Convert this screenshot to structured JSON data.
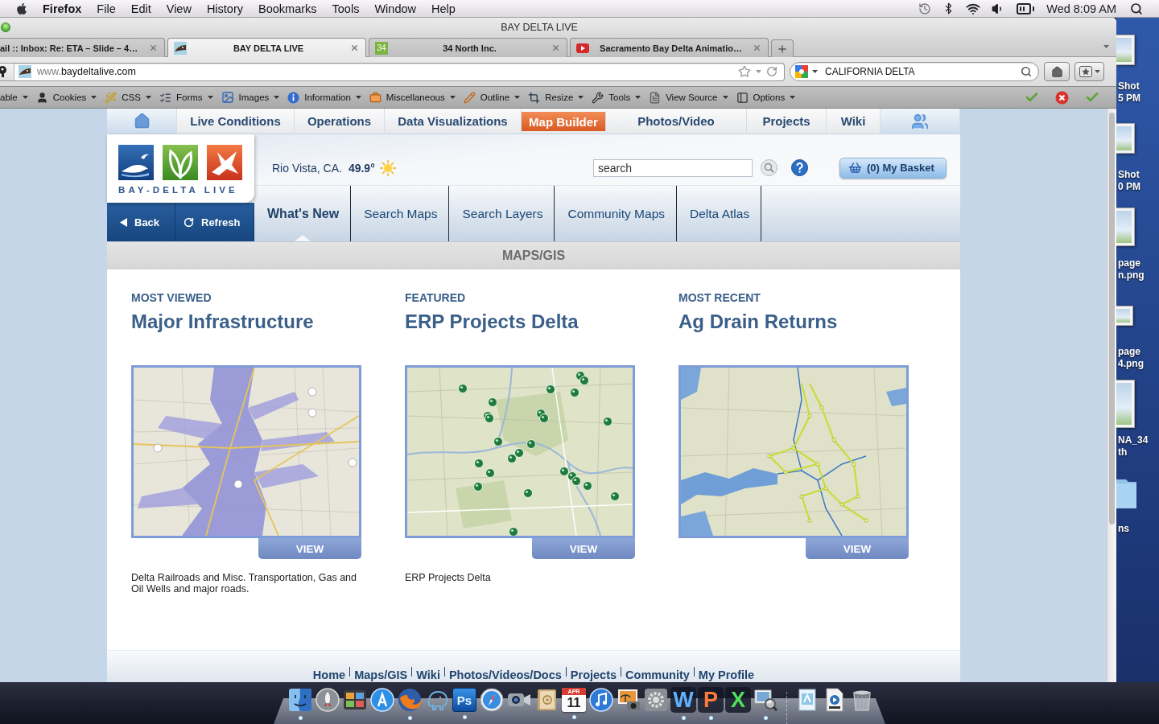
{
  "menu_bar": {
    "app": "Firefox",
    "menus": [
      "File",
      "Edit",
      "View",
      "History",
      "Bookmarks",
      "Tools",
      "Window",
      "Help"
    ],
    "clock": "Wed 8:09 AM"
  },
  "window": {
    "title": "BAY DELTA LIVE"
  },
  "tabs": [
    {
      "kind": "plain",
      "label": "ail :: Inbox: Re: ETA – Slide – 4…",
      "selected": false
    },
    {
      "kind": "site",
      "label": "BAY DELTA LIVE",
      "selected": true
    },
    {
      "kind": "badge",
      "badge": "34",
      "label": "34 North Inc.",
      "selected": false
    },
    {
      "kind": "video",
      "label": "Sacramento Bay Delta Animatio…",
      "selected": false
    }
  ],
  "address_bar": {
    "prefix": "www.",
    "domain": "baydeltalive.com"
  },
  "search_bar": {
    "value": "CALIFORNIA DELTA"
  },
  "dev_toolbar": {
    "items": [
      "able",
      "Cookies",
      "CSS",
      "Forms",
      "Images",
      "Information",
      "Miscellaneous",
      "Outline",
      "Resize",
      "Tools",
      "View Source",
      "Options"
    ]
  },
  "site": {
    "nav": [
      {
        "kind": "home",
        "selected": false
      },
      {
        "kind": "link",
        "label": "Live Conditions",
        "selected": false
      },
      {
        "kind": "link",
        "label": "Operations",
        "selected": false
      },
      {
        "kind": "link",
        "label": "Data Visualizations",
        "selected": false
      },
      {
        "kind": "link",
        "label": "Map Builder",
        "selected": true
      },
      {
        "kind": "link",
        "label": "Photos/Video",
        "selected": false
      },
      {
        "kind": "link",
        "label": "Projects",
        "selected": false
      },
      {
        "kind": "link",
        "label": "Wiki",
        "selected": false
      },
      {
        "kind": "people",
        "selected": false
      }
    ],
    "logo_text": "BAY-DELTA LIVE",
    "weather": {
      "location": "Rio Vista, CA.",
      "temperature": "49.9°"
    },
    "search": {
      "placeholder": "search"
    },
    "basket": "(0) My Basket",
    "actions": [
      "Back",
      "Refresh"
    ],
    "tabs": [
      {
        "label": "What's New",
        "selected": true
      },
      {
        "label": "Search Maps",
        "selected": false
      },
      {
        "label": "Search Layers",
        "selected": false
      },
      {
        "label": "Community Maps",
        "selected": false
      },
      {
        "label": "Delta Atlas",
        "selected": false
      }
    ],
    "section_title": "MAPS/GIS",
    "cards": [
      {
        "kind": "shaded",
        "category": "MOST VIEWED",
        "title": "Major Infrastructure",
        "button": "VIEW",
        "description": "Delta Railroads and Misc. Transportation, Gas and Oil Wells and major roads."
      },
      {
        "kind": "markers",
        "category": "FEATURED",
        "title": "ERP Projects Delta",
        "button": "VIEW",
        "description": "ERP Projects Delta"
      },
      {
        "kind": "network",
        "category": "MOST RECENT",
        "title": "Ag Drain Returns",
        "button": "VIEW"
      }
    ],
    "footer_links": [
      "Home",
      "Maps/GIS",
      "Wiki",
      "Photos/Videos/Docs",
      "Projects",
      "Community",
      "My Profile"
    ]
  },
  "desktop_items": [
    {
      "lines": [
        "Shot",
        "5 PM"
      ]
    },
    {
      "lines": [
        "Shot",
        "0 PM"
      ]
    },
    {
      "lines": [
        "page",
        "n.png"
      ]
    },
    {
      "lines": [
        "page",
        "4.png"
      ]
    },
    {
      "lines": [
        "NA_34",
        "th"
      ]
    },
    {
      "lines": [
        "ns"
      ]
    }
  ],
  "dock": [
    {
      "running": true
    },
    {
      "running": false
    },
    {
      "running": false
    },
    {
      "running": false
    },
    {
      "running": true
    },
    {
      "running": false
    },
    {
      "text": "Ps",
      "running": true
    },
    {
      "running": false
    },
    {
      "running": false
    },
    {
      "running": false
    },
    {
      "month": "APR",
      "day": "11",
      "running": true
    },
    {
      "running": false
    },
    {
      "running": false
    },
    {
      "running": false
    },
    {
      "text": "W",
      "running": true
    },
    {
      "text": "P",
      "running": true
    },
    {
      "text": "X",
      "running": false
    },
    {
      "running": true
    },
    {
      "running": false
    },
    {
      "running": false
    },
    {
      "running": false
    }
  ]
}
